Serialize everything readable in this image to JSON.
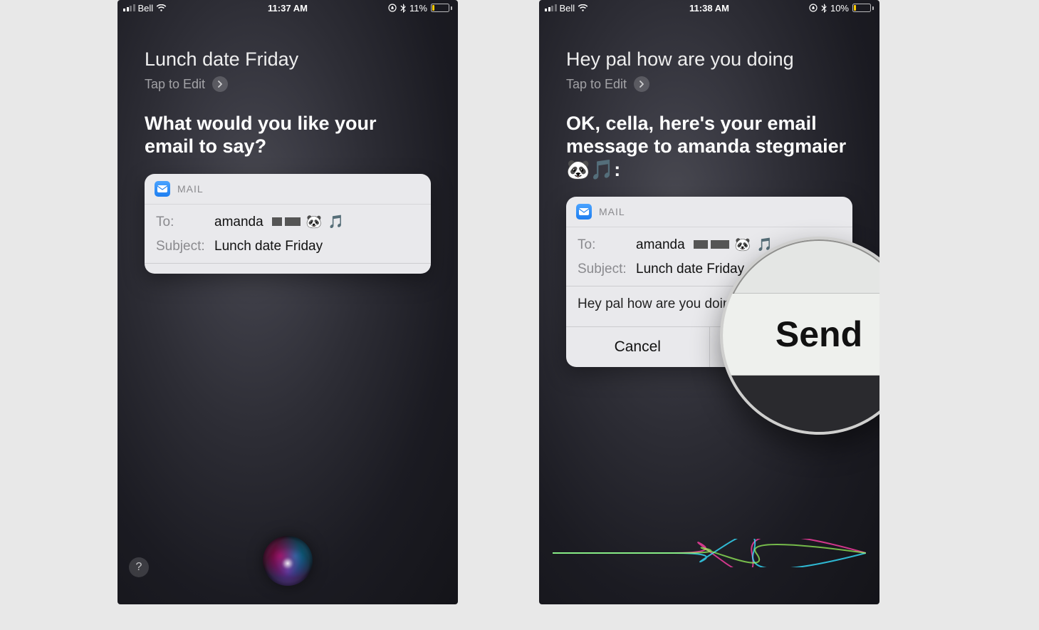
{
  "left": {
    "status": {
      "carrier": "Bell",
      "time": "11:37 AM",
      "battery_pct": "11%"
    },
    "utterance": "Lunch date Friday",
    "tap_to_edit": "Tap to Edit",
    "siri_response": "What would you like your email to say?",
    "mail": {
      "app_label": "MAIL",
      "to_label": "To:",
      "to_value": "amanda",
      "to_emoji": "🐼 🎵",
      "subject_label": "Subject:",
      "subject_value": "Lunch date Friday"
    },
    "help": "?"
  },
  "right": {
    "status": {
      "carrier": "Bell",
      "time": "11:38 AM",
      "battery_pct": "10%"
    },
    "utterance": "Hey pal how are you doing",
    "tap_to_edit": "Tap to Edit",
    "siri_response": "OK, cella, here's your email message to amanda stegmaier 🐼🎵:",
    "mail": {
      "app_label": "MAIL",
      "to_label": "To:",
      "to_value": "amanda",
      "to_emoji": "🐼 🎵",
      "subject_label": "Subject:",
      "subject_value": "Lunch date Friday",
      "body": "Hey pal how are you doing",
      "cancel": "Cancel",
      "send": "Send"
    },
    "magnified_label": "Send"
  }
}
